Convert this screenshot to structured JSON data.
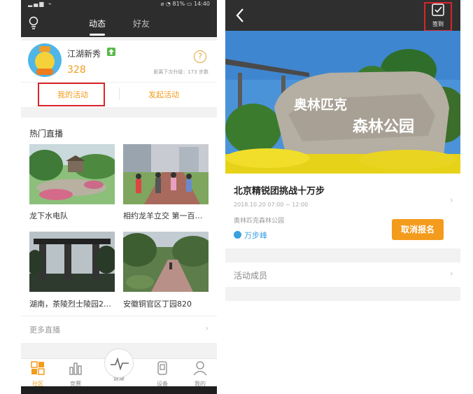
{
  "left": {
    "status": {
      "time": "14:40",
      "battery": "81%"
    },
    "tabs": [
      {
        "label": "动态"
      },
      {
        "label": "好友"
      }
    ],
    "profile": {
      "name": "江湖新秀",
      "score": "328",
      "next_level": "距离下次升级：173 步数",
      "my_activity": "我的活动",
      "start_activity": "发起活动"
    },
    "live": {
      "title": "热门直播",
      "items": [
        {
          "label": "龙下水电队"
        },
        {
          "label": "相约龙羊立交 第一百…"
        },
        {
          "label": "湖南，茶陵烈士陵园2…"
        },
        {
          "label": "安徽铜官区丁园820"
        }
      ],
      "more": "更多直播"
    },
    "bottom_nav": [
      {
        "label": "社区"
      },
      {
        "label": "竞赛"
      },
      {
        "label": "健康"
      },
      {
        "label": "设备"
      },
      {
        "label": "我的"
      }
    ]
  },
  "right": {
    "checkin": "签到",
    "hero_stone_text_1": "奥林匹克",
    "hero_stone_text_2": "森林公园",
    "event": {
      "title": "北京精锐团挑战十万步",
      "time": "2018.10.20 07:00 ~ 12:00",
      "place": "奥林匹克森林公园",
      "organizer": "万步峰",
      "cancel": "取消报名"
    },
    "members": "活动成员"
  },
  "colors": {
    "accent": "#f39b1c",
    "highlight_box": "#d9252b",
    "link": "#3aa0e0"
  }
}
